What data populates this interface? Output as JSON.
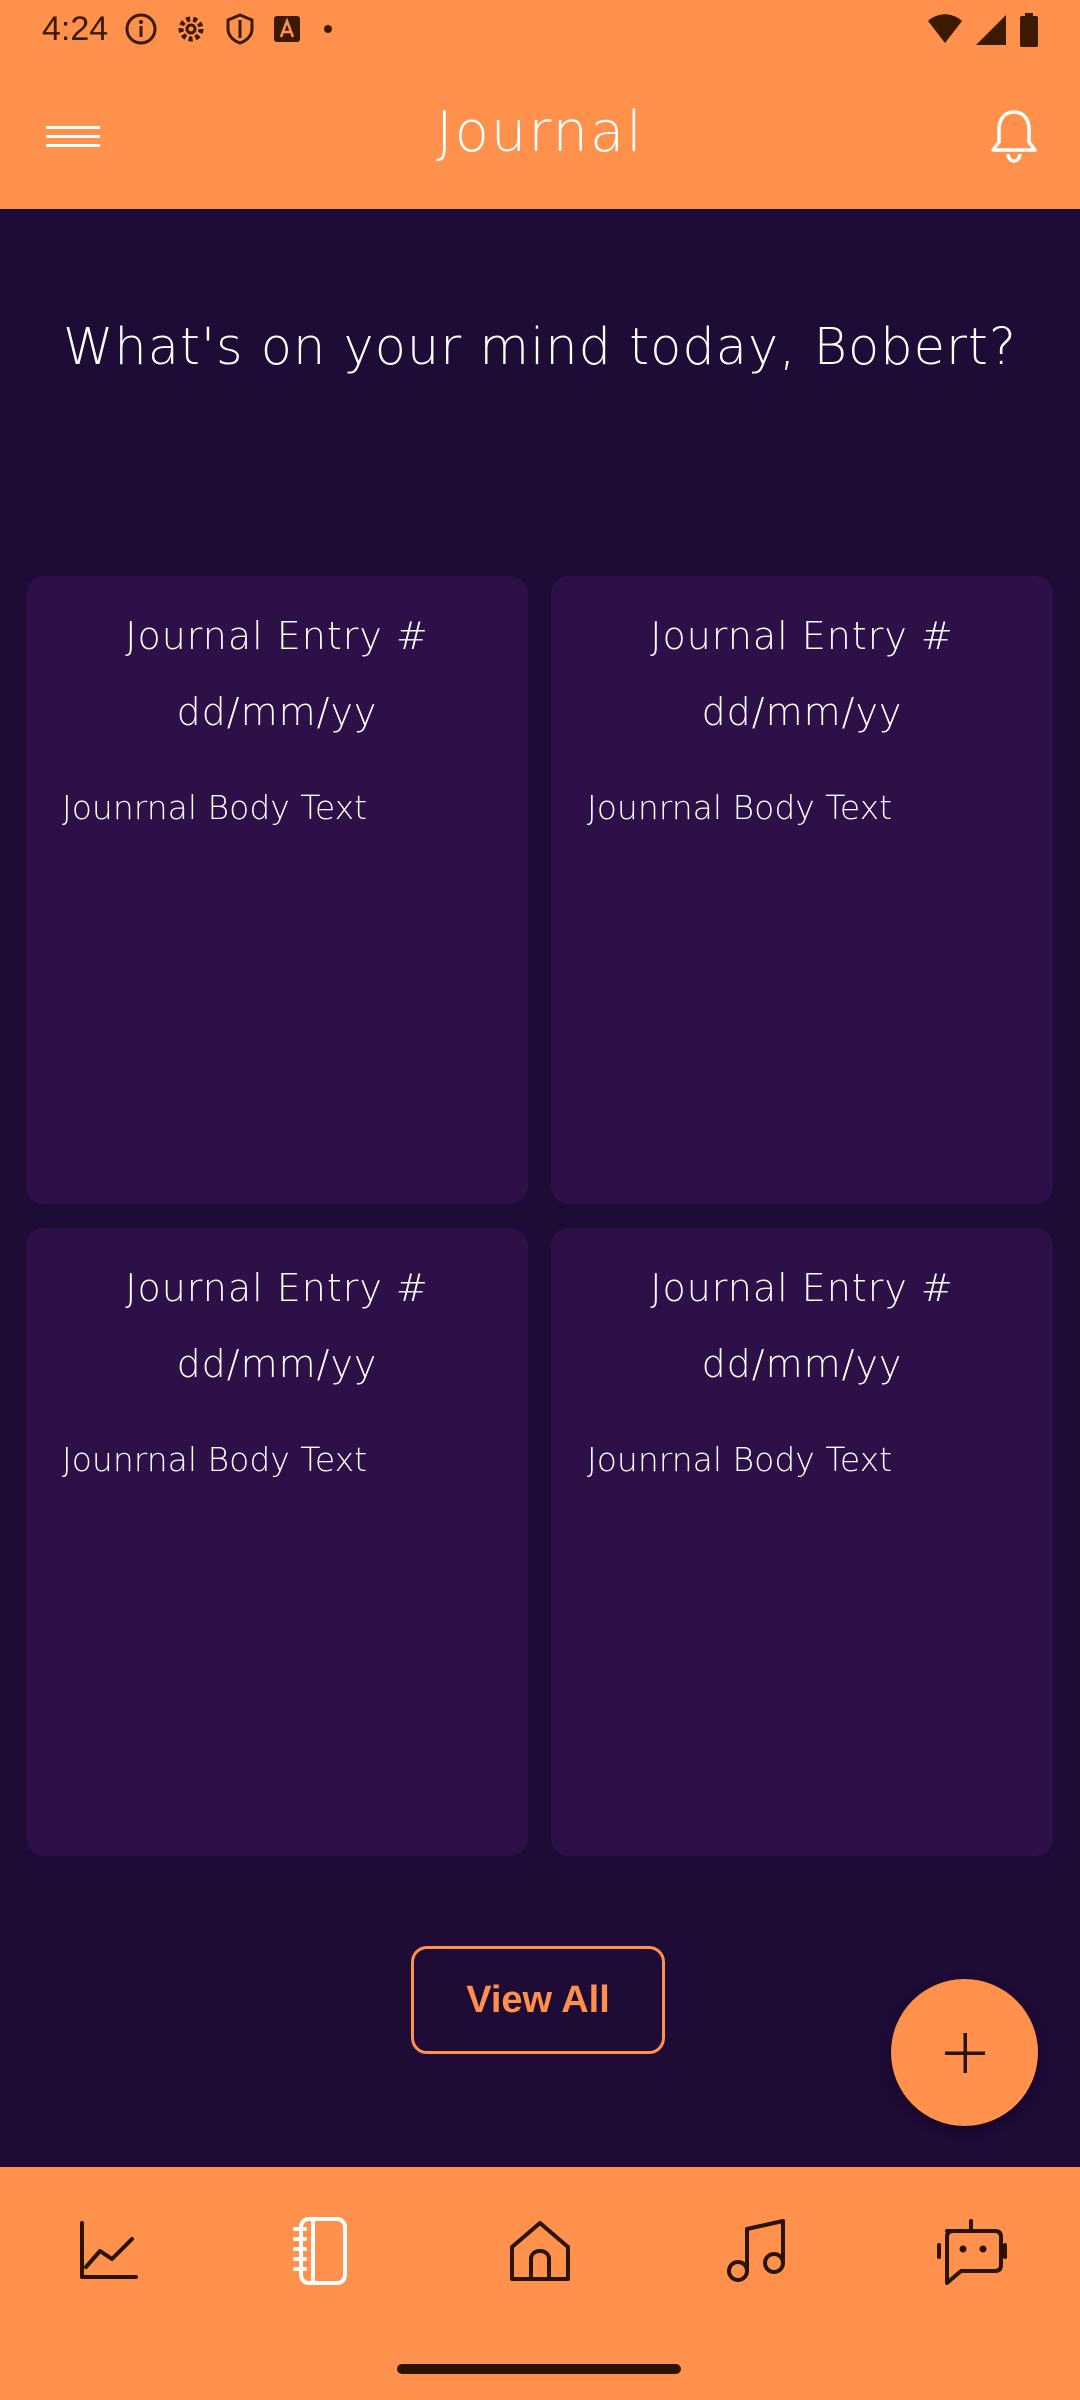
{
  "status_bar": {
    "time": "4:24"
  },
  "app_bar": {
    "title": "Journal"
  },
  "greeting": "What's on your mind today, Bobert?",
  "entries": [
    {
      "title": "Journal Entry #",
      "date": "dd/mm/yy",
      "body": "Jounrnal Body Text"
    },
    {
      "title": "Journal Entry #",
      "date": "dd/mm/yy",
      "body": "Jounrnal Body Text"
    },
    {
      "title": "Journal Entry #",
      "date": "dd/mm/yy",
      "body": "Jounrnal Body Text"
    },
    {
      "title": "Journal Entry #",
      "date": "dd/mm/yy",
      "body": "Jounrnal Body Text"
    }
  ],
  "view_all_label": "View All",
  "bottom_nav": {
    "items": [
      {
        "icon": "chart-line-icon"
      },
      {
        "icon": "journal-icon",
        "selected": true
      },
      {
        "icon": "home-icon"
      },
      {
        "icon": "music-note-icon"
      },
      {
        "icon": "chat-bot-icon"
      }
    ]
  },
  "colors": {
    "accent": "#ff914d",
    "background": "#1e0b36",
    "card": "#2c1047"
  }
}
